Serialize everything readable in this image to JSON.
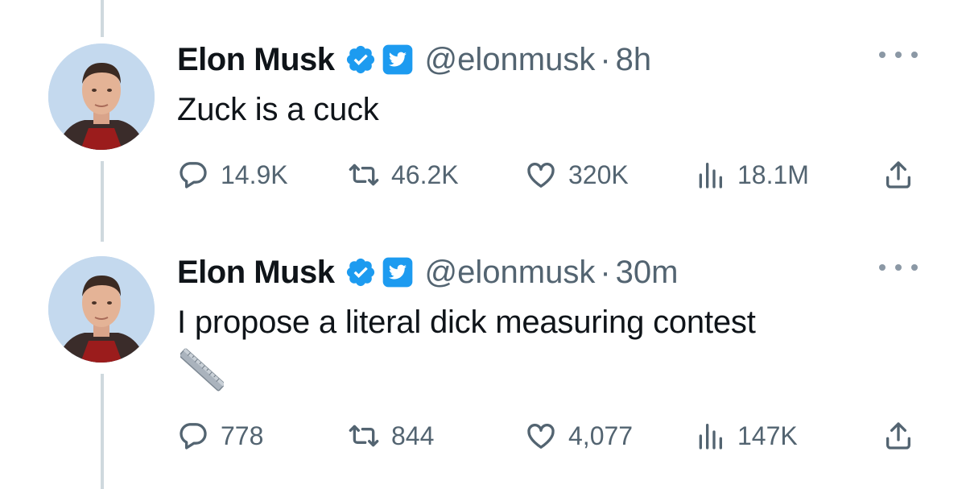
{
  "tweets": [
    {
      "name": "Elon Musk",
      "handle": "@elonmusk",
      "separator": "·",
      "time": "8h",
      "text": "Zuck is a cuck",
      "emoji": null,
      "replies": "14.9K",
      "retweets": "46.2K",
      "likes": "320K",
      "views": "18.1M"
    },
    {
      "name": "Elon Musk",
      "handle": "@elonmusk",
      "separator": "·",
      "time": "30m",
      "text": "I propose a literal dick measuring contest",
      "emoji": "straight-ruler-emoji",
      "replies": "778",
      "retweets": "844",
      "likes": "4,077",
      "views": "147K"
    }
  ],
  "icons": {
    "verified": "verified-badge-icon",
    "affiliate": "twitter-bird-badge-icon",
    "more": "more-options-icon",
    "reply": "reply-icon",
    "retweet": "retweet-icon",
    "like": "heart-icon",
    "views": "views-chart-icon",
    "share": "share-icon"
  },
  "colors": {
    "verified_blue": "#1d9bf0",
    "secondary_text": "#536471",
    "thread_line": "#cfd9de"
  }
}
